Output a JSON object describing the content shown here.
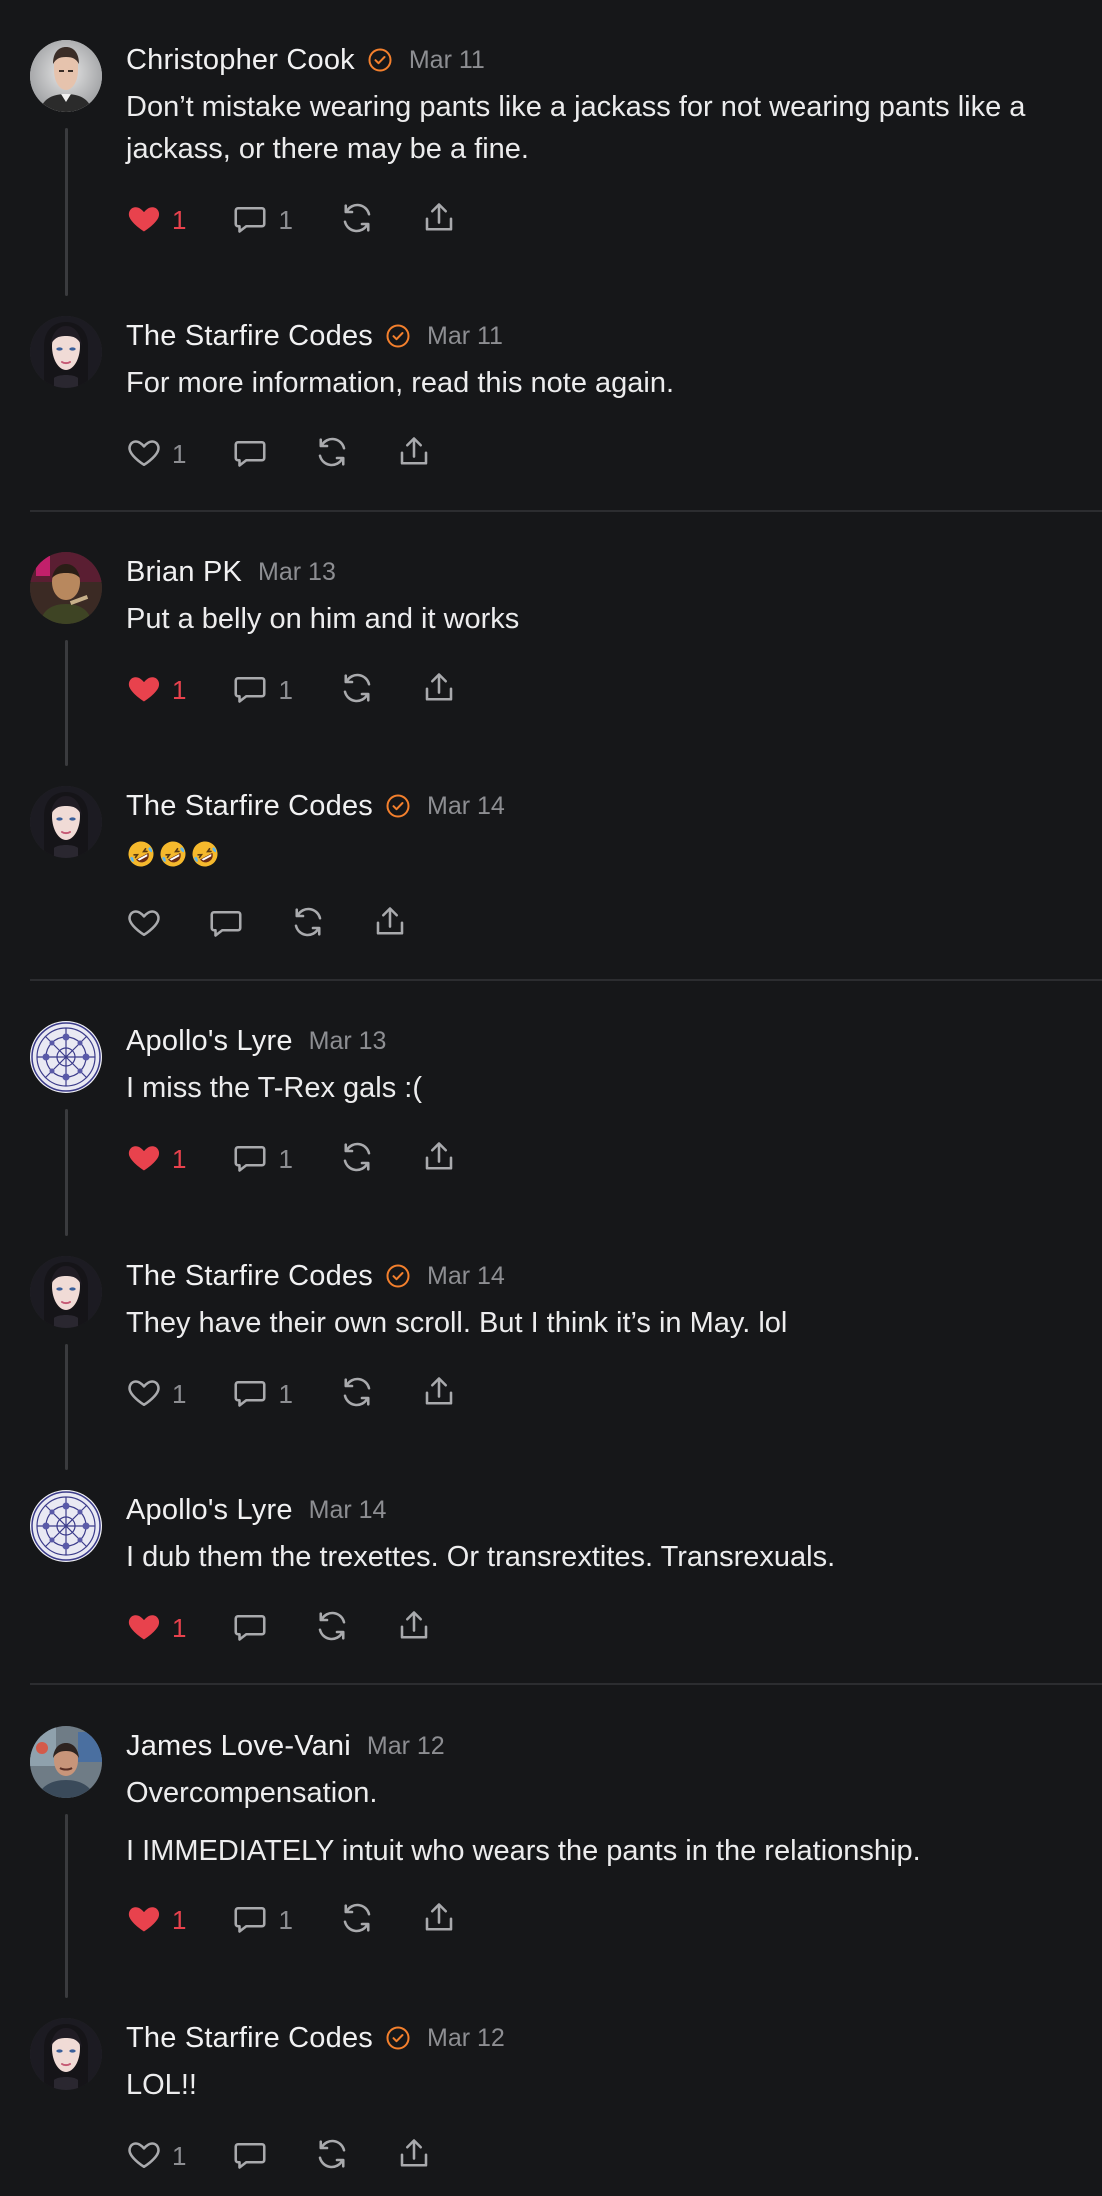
{
  "comments": [
    {
      "id": "c1",
      "author": "Christopher Cook",
      "verified": true,
      "date": "Mar 11",
      "avatar": "avatar-christopher-cook",
      "paragraphs": [
        "Don’t mistake wearing pants like a jackass for not wearing pants like a jackass, or there may be a fine."
      ],
      "likes": "1",
      "liked": true,
      "replies": "1",
      "thread": true
    },
    {
      "id": "c2",
      "author": "The Starfire Codes",
      "verified": true,
      "date": "Mar 11",
      "avatar": "avatar-starfire-codes",
      "paragraphs": [
        "For more information, read this note again."
      ],
      "likes": "1",
      "liked": false,
      "replies": "",
      "thread": false
    },
    {
      "id": "c3",
      "author": "Brian PK",
      "verified": false,
      "date": "Mar 13",
      "avatar": "avatar-brian-pk",
      "paragraphs": [
        "Put a belly on him and it works"
      ],
      "likes": "1",
      "liked": true,
      "replies": "1",
      "thread": true
    },
    {
      "id": "c4",
      "author": "The Starfire Codes",
      "verified": true,
      "date": "Mar 14",
      "avatar": "avatar-starfire-codes",
      "paragraphs": [],
      "emoji_count": 3,
      "likes": "",
      "liked": false,
      "replies": "",
      "thread": false
    },
    {
      "id": "c5",
      "author": "Apollo's Lyre",
      "verified": false,
      "date": "Mar 13",
      "avatar": "avatar-apollos-lyre",
      "paragraphs": [
        "I miss the T-Rex gals :("
      ],
      "likes": "1",
      "liked": true,
      "replies": "1",
      "thread": true
    },
    {
      "id": "c6",
      "author": "The Starfire Codes",
      "verified": true,
      "date": "Mar 14",
      "avatar": "avatar-starfire-codes",
      "paragraphs": [
        "They have their own scroll. But I think it’s in May. lol"
      ],
      "likes": "1",
      "liked": false,
      "replies": "1",
      "thread": true
    },
    {
      "id": "c7",
      "author": "Apollo's Lyre",
      "verified": false,
      "date": "Mar 14",
      "avatar": "avatar-apollos-lyre",
      "paragraphs": [
        "I dub them the trexettes. Or transrextites. Transrexuals."
      ],
      "likes": "1",
      "liked": true,
      "replies": "",
      "thread": false
    },
    {
      "id": "c8",
      "author": "James Love-Vani",
      "verified": false,
      "date": "Mar 12",
      "avatar": "avatar-james-love-vani",
      "paragraphs": [
        "Overcompensation.",
        "I IMMEDIATELY intuit who wears the pants in the relationship."
      ],
      "likes": "1",
      "liked": true,
      "replies": "1",
      "thread": true
    },
    {
      "id": "c9",
      "author": "The Starfire Codes",
      "verified": true,
      "date": "Mar 12",
      "avatar": "avatar-starfire-codes",
      "paragraphs": [
        "LOL!!"
      ],
      "likes": "1",
      "liked": false,
      "replies": "",
      "thread": false
    }
  ],
  "colors": {
    "background": "#161719",
    "like_active": "#e8424d",
    "verified_badge": "#f4802d",
    "muted_text": "#8d8e92"
  },
  "icons": {
    "like": "heart-icon",
    "reply": "comment-bubble-icon",
    "restack": "restack-icon",
    "share": "share-icon",
    "verified": "verified-check-icon",
    "emoji": "rolling-on-floor-laughing-emoji"
  }
}
